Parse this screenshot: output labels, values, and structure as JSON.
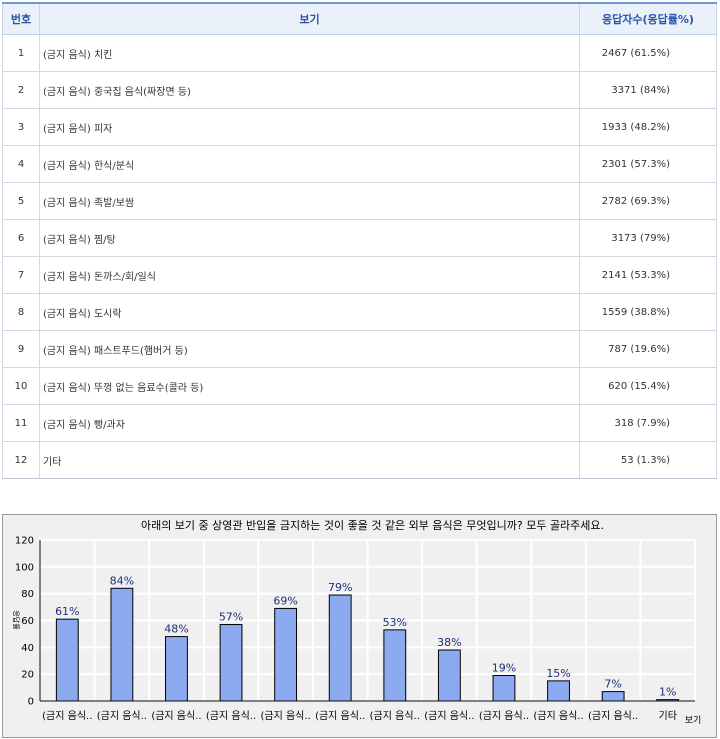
{
  "table": {
    "headers": {
      "no": "번호",
      "option": "보기",
      "count": "응답자수(응답률%)"
    },
    "rows": [
      {
        "no": "1",
        "option": "(금지 음식) 치킨",
        "count": "2467 (61.5%)"
      },
      {
        "no": "2",
        "option": "(금지 음식) 중국집 음식(짜장면 등)",
        "count": "3371 (84%)"
      },
      {
        "no": "3",
        "option": "(금지 음식) 피자",
        "count": "1933 (48.2%)"
      },
      {
        "no": "4",
        "option": "(금지 음식) 한식/분식",
        "count": "2301 (57.3%)"
      },
      {
        "no": "5",
        "option": "(금지 음식) 족발/보쌈",
        "count": "2782 (69.3%)"
      },
      {
        "no": "6",
        "option": "(금지 음식) 찜/탕",
        "count": "3173 (79%)"
      },
      {
        "no": "7",
        "option": "(금지 음식) 돈까스/회/일식",
        "count": "2141 (53.3%)"
      },
      {
        "no": "8",
        "option": "(금지 음식) 도시락",
        "count": "1559 (38.8%)"
      },
      {
        "no": "9",
        "option": "(금지 음식) 패스트푸드(햄버거 등)",
        "count": "787 (19.6%)"
      },
      {
        "no": "10",
        "option": "(금지 음식) 뚜껑 없는 음료수(콜라 등)",
        "count": "620 (15.4%)"
      },
      {
        "no": "11",
        "option": "(금지 음식) 빵/과자",
        "count": "318 (7.9%)"
      },
      {
        "no": "12",
        "option": "기타",
        "count": "53 (1.3%)"
      }
    ]
  },
  "chart_data": {
    "type": "bar",
    "title": "아래의 보기 중 상영관 반입을 금지하는 것이 좋을 것 같은 외부 음식은 무엇입니까? 모두 골라주세요.",
    "xlabel": "보기",
    "ylabel": "응답률",
    "ylim": [
      0,
      120
    ],
    "yticks": [
      0,
      20,
      40,
      60,
      80,
      100,
      120
    ],
    "categories": [
      "(금지 음식..",
      "(금지 음식..",
      "(금지 음식..",
      "(금지 음식..",
      "(금지 음식..",
      "(금지 음식..",
      "(금지 음식..",
      "(금지 음식..",
      "(금지 음식..",
      "(금지 음식..",
      "(금지 음식..",
      "기타"
    ],
    "values": [
      61,
      84,
      48,
      57,
      69,
      79,
      53,
      38,
      19,
      15,
      7,
      1
    ],
    "value_labels": [
      "61%",
      "84%",
      "48%",
      "57%",
      "69%",
      "79%",
      "53%",
      "38%",
      "19%",
      "15%",
      "7%",
      "1%"
    ],
    "grid": true,
    "colors": {
      "bar": "#8caaf0",
      "bar_stroke": "#000000",
      "label": "#1f2f7a",
      "grid": "#ffffff",
      "plot_bg": "#f0f0f0"
    }
  }
}
